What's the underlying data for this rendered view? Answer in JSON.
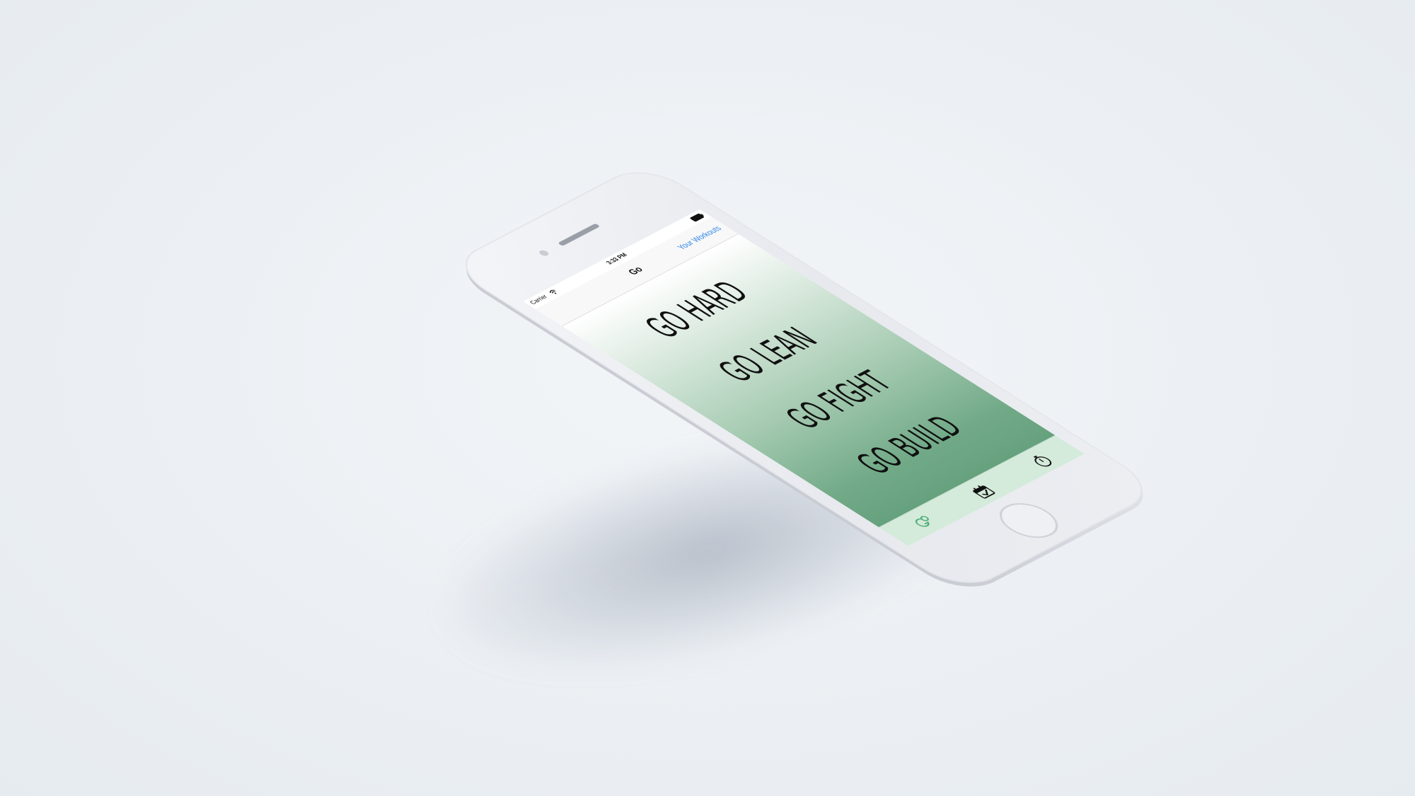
{
  "status_bar": {
    "carrier": "Carrier",
    "time": "3:33 PM"
  },
  "nav_bar": {
    "title": "Go",
    "right_button": "Your Workouts"
  },
  "workouts": [
    {
      "label": "GO HARD"
    },
    {
      "label": "GO LEAN"
    },
    {
      "label": "GO FIGHT"
    },
    {
      "label": "GO BUILD"
    }
  ],
  "tab_bar": {
    "tabs": [
      {
        "icon": "go-logo-icon",
        "selected": true
      },
      {
        "icon": "calendar-check-icon",
        "selected": false
      },
      {
        "icon": "stopwatch-icon",
        "selected": false
      }
    ]
  },
  "colors": {
    "accent": "#2f86e8",
    "tab_active": "#4fae76",
    "gradient_bottom": "#66a17e",
    "tab_bar_bg": "#d4eadb"
  }
}
